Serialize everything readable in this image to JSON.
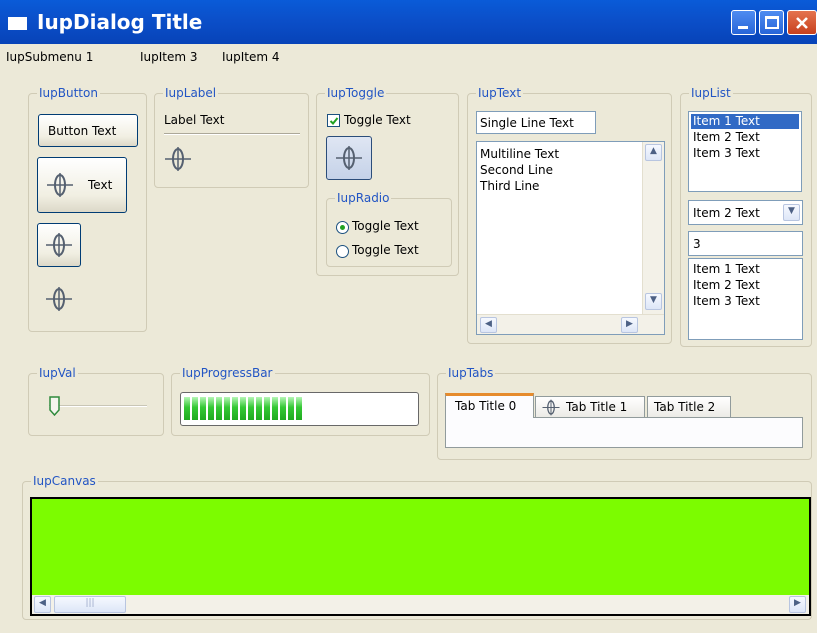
{
  "window": {
    "title": "IupDialog Title"
  },
  "menu": {
    "items": [
      "IupSubmenu 1",
      "IupItem 3",
      "IupItem 4"
    ]
  },
  "frames": {
    "button": "IupButton",
    "label": "IupLabel",
    "toggle": "IupToggle",
    "radio": "IupRadio",
    "text": "IupText",
    "list": "IupList",
    "val": "IupVal",
    "progressbar": "IupProgressBar",
    "tabs": "IupTabs",
    "canvas": "IupCanvas"
  },
  "buttons": {
    "text_button": "Button Text",
    "image_text_button": "Text"
  },
  "label": {
    "text": "Label Text"
  },
  "toggle": {
    "label": "Toggle Text",
    "checked": true
  },
  "radio": {
    "options": [
      "Toggle Text",
      "Toggle Text"
    ],
    "selected_index": 0
  },
  "text": {
    "single_line": "Single Line Text",
    "multiline": [
      "Multiline Text",
      "Second Line",
      "Third Line"
    ]
  },
  "list": {
    "items": [
      "Item 1 Text",
      "Item 2 Text",
      "Item 3 Text"
    ],
    "selected_index": 0,
    "dropdown_value": "Item 2 Text",
    "edit_value": "3",
    "edit_list_items": [
      "Item 1 Text",
      "Item 2 Text",
      "Item 3 Text"
    ]
  },
  "val": {
    "value_fraction": 0.0
  },
  "progress": {
    "value_fraction": 0.53
  },
  "tabs": {
    "titles": [
      "Tab Title 0",
      "Tab Title 1",
      "Tab Title 2"
    ],
    "active_index": 0
  },
  "canvas": {
    "color": "#7cfc00"
  },
  "icons": {
    "image": "crosshair-ring-icon"
  },
  "colors": {
    "titlebar": "#0b4fc9",
    "frame_legend": "#2255c4",
    "selection": "#316ac5",
    "progress": "#34c834"
  }
}
